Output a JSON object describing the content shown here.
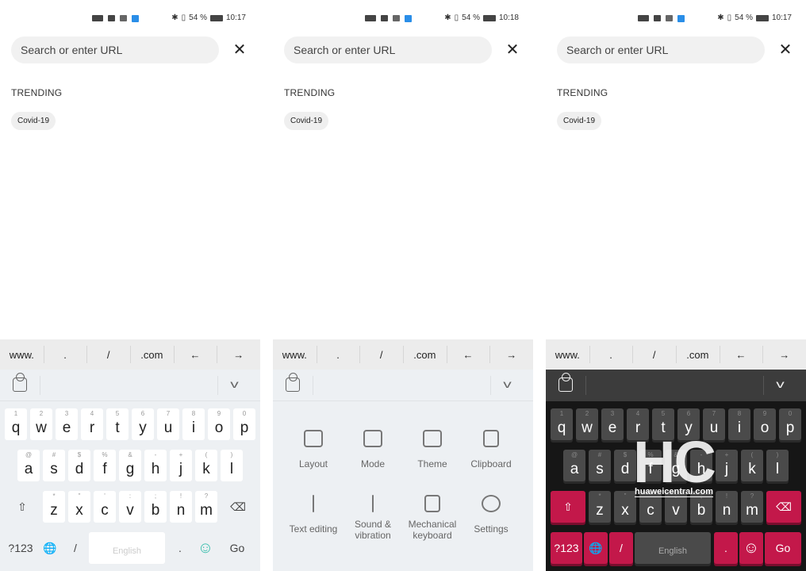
{
  "panels": [
    {
      "time": "10:17",
      "battery": "54 %",
      "theme": "light",
      "view": "keys"
    },
    {
      "time": "10:18",
      "battery": "54 %",
      "theme": "light",
      "view": "menu"
    },
    {
      "time": "10:17",
      "battery": "54 %",
      "theme": "dark",
      "view": "keys"
    }
  ],
  "search_placeholder": "Search or enter URL",
  "trending_label": "TRENDING",
  "trending_chips": [
    "Covid-19"
  ],
  "url_keys": [
    "www.",
    ".",
    "/",
    ".com",
    "←",
    "→"
  ],
  "rows": [
    {
      "keys": [
        "q",
        "w",
        "e",
        "r",
        "t",
        "y",
        "u",
        "i",
        "o",
        "p"
      ],
      "hints": [
        "1",
        "2",
        "3",
        "4",
        "5",
        "6",
        "7",
        "8",
        "9",
        "0"
      ]
    },
    {
      "keys": [
        "a",
        "s",
        "d",
        "f",
        "g",
        "h",
        "j",
        "k",
        "l"
      ],
      "hints": [
        "@",
        "#",
        "$",
        "%",
        "&",
        "-",
        "+",
        "(",
        ")"
      ]
    },
    {
      "keys": [
        "z",
        "x",
        "c",
        "v",
        "b",
        "n",
        "m"
      ],
      "hints": [
        "*",
        "\"",
        "'",
        ":",
        ";",
        "!",
        "?"
      ]
    }
  ],
  "bottom_keys": {
    "symbols": "?123",
    "slash": "/",
    "space": "English",
    "period": ".",
    "go": "Go"
  },
  "menu_items": [
    "Layout",
    "Mode",
    "Theme",
    "Clipboard",
    "Text editing",
    "Sound & vibration",
    "Mechanical keyboard",
    "Settings"
  ],
  "colors": {
    "accent_dark_theme": "#c3184a",
    "emoji_light": "#3cbfae"
  },
  "watermark": {
    "logo": "HC",
    "site": "huaweicentral.com"
  }
}
